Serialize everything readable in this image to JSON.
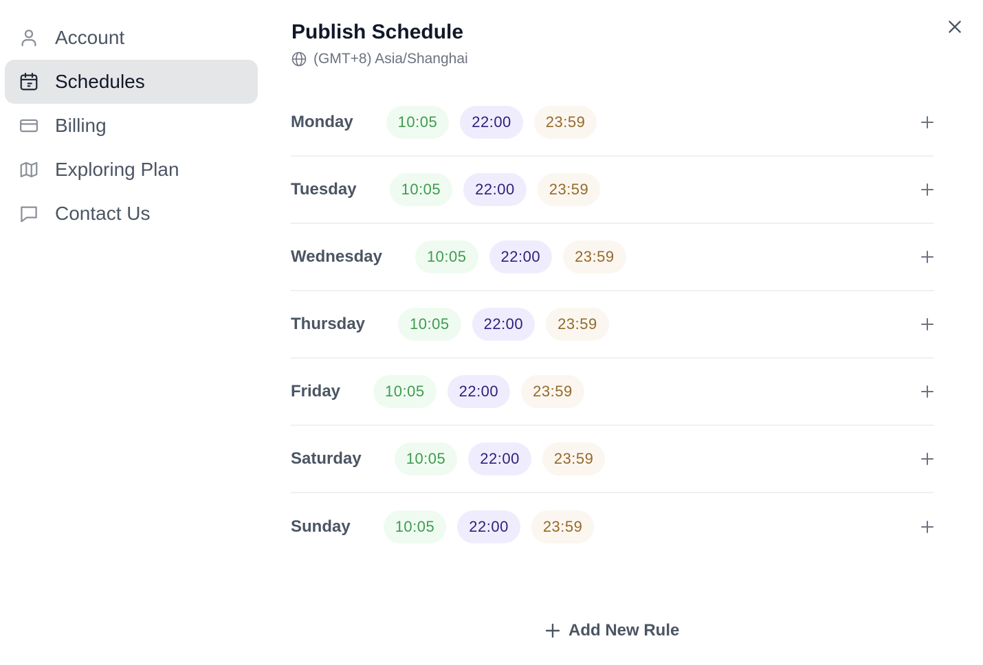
{
  "sidebar": {
    "items": [
      {
        "label": "Account",
        "icon": "user-icon",
        "active": false
      },
      {
        "label": "Schedules",
        "icon": "calendar-icon",
        "active": true
      },
      {
        "label": "Billing",
        "icon": "credit-card-icon",
        "active": false
      },
      {
        "label": "Exploring Plan",
        "icon": "map-icon",
        "active": false
      },
      {
        "label": "Contact Us",
        "icon": "chat-bubble-icon",
        "active": false
      }
    ]
  },
  "header": {
    "title": "Publish Schedule",
    "timezone": "(GMT+8) Asia/Shanghai",
    "close_icon": "close-icon"
  },
  "schedule": {
    "days": [
      {
        "day": "Monday",
        "times": [
          "10:05",
          "22:00",
          "23:59"
        ]
      },
      {
        "day": "Tuesday",
        "times": [
          "10:05",
          "22:00",
          "23:59"
        ]
      },
      {
        "day": "Wednesday",
        "times": [
          "10:05",
          "22:00",
          "23:59"
        ]
      },
      {
        "day": "Thursday",
        "times": [
          "10:05",
          "22:00",
          "23:59"
        ]
      },
      {
        "day": "Friday",
        "times": [
          "10:05",
          "22:00",
          "23:59"
        ]
      },
      {
        "day": "Saturday",
        "times": [
          "10:05",
          "22:00",
          "23:59"
        ]
      },
      {
        "day": "Sunday",
        "times": [
          "10:05",
          "22:00",
          "23:59"
        ]
      }
    ]
  },
  "footer": {
    "add_rule_label": "Add New Rule"
  },
  "colors": {
    "chip_green_bg": "#effbf1",
    "chip_green_text": "#3f9b4e",
    "chip_purple_bg": "#efedfd",
    "chip_purple_text": "#2e1f7a",
    "chip_amber_bg": "#fbf6ef",
    "chip_amber_text": "#946a2c",
    "active_nav_bg": "#e5e6e8"
  }
}
